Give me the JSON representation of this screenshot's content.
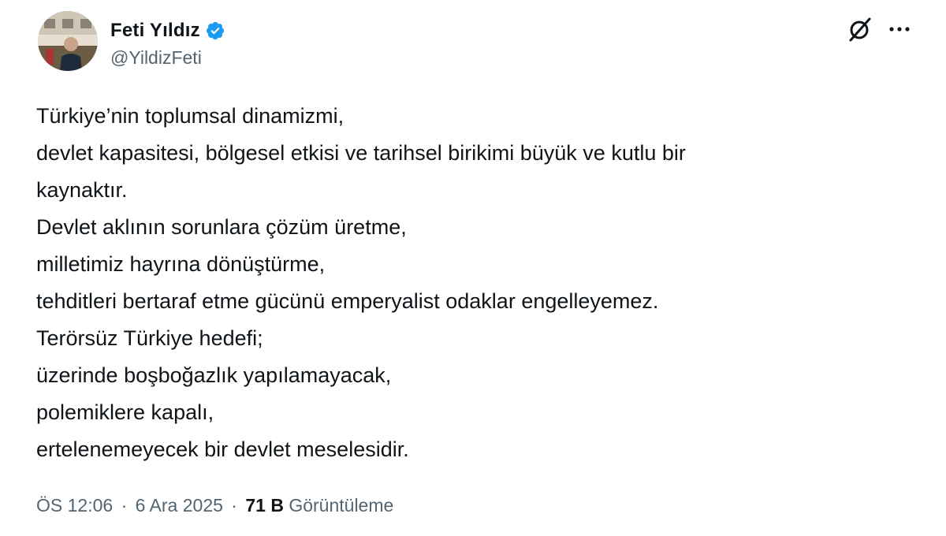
{
  "author": {
    "display_name": "Feti Yıldız",
    "handle": "@YildizFeti",
    "verified_icon": "verified-badge-icon",
    "verified_color": "#1d9bf0"
  },
  "actions": {
    "grok_icon": "grok-icon",
    "more_icon": "more-options-icon"
  },
  "tweet": {
    "lines": [
      "Türkiye’nin toplumsal dinamizmi,",
      "devlet kapasitesi, bölgesel etkisi ve tarihsel birikimi büyük ve kutlu bir",
      "kaynaktır.",
      "Devlet aklının sorunlara çözüm üretme,",
      "milletimiz hayrına dönüştürme,",
      "tehditleri bertaraf etme gücünü emperyalist odaklar engelleyemez.",
      "Terörsüz Türkiye hedefi;",
      "üzerinde boşboğazlık yapılamayacak,",
      "polemiklere kapalı,",
      "ertelenemeyecek bir devlet meselesidir."
    ]
  },
  "meta": {
    "time": "ÖS 12:06",
    "separator": "·",
    "date": "6 Ara 2025",
    "views_count": "71 B",
    "views_label": "Görüntüleme"
  },
  "colors": {
    "text": "#0f1419",
    "secondary": "#536471",
    "background": "#ffffff"
  }
}
